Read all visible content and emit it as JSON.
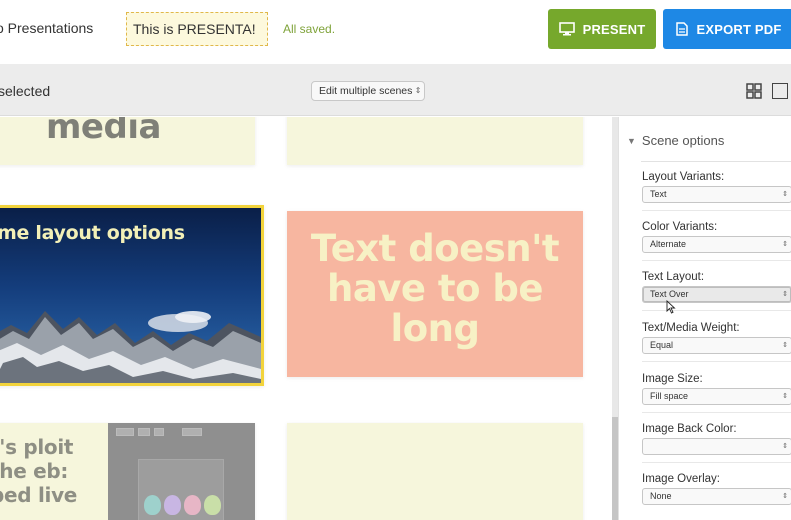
{
  "header": {
    "back_label": "o Presentations",
    "presentation_title": "This is PRESENTA!",
    "save_status": "All saved.",
    "present_label": "PRESENT",
    "export_label": "EXPORT PDF",
    "present_color": "#76a82c",
    "export_color": "#1e88e5"
  },
  "toolbar": {
    "selected_label": "selected",
    "edit_multiple_label": "Edit multiple scenes",
    "grid_view_icon": "grid-view-icon",
    "single_view_icon": "single-view-icon"
  },
  "scenes": [
    {
      "text": "media",
      "background": "#f6f6dc"
    },
    {
      "text": "",
      "background": "#f6f6dc"
    },
    {
      "text": "me layout options",
      "background": "mountain-photo",
      "selected": true
    },
    {
      "text": "Text doesn't have to be long",
      "background": "#f7b6a0"
    },
    {
      "text": "t's ploit the eb: bed live",
      "background": "#f6f6dc"
    },
    {
      "text": "",
      "background": "#f6f6dc"
    }
  ],
  "panel": {
    "title": "Scene options",
    "options": [
      {
        "label": "Layout Variants:",
        "value": "Text"
      },
      {
        "label": "Color Variants:",
        "value": "Alternate"
      },
      {
        "label": "Text Layout:",
        "value": "Text Over"
      },
      {
        "label": "Text/Media Weight:",
        "value": "Equal"
      },
      {
        "label": "Image Size:",
        "value": "Fill space"
      },
      {
        "label": "Image Back Color:",
        "value": ""
      },
      {
        "label": "Image Overlay:",
        "value": "None"
      }
    ]
  }
}
